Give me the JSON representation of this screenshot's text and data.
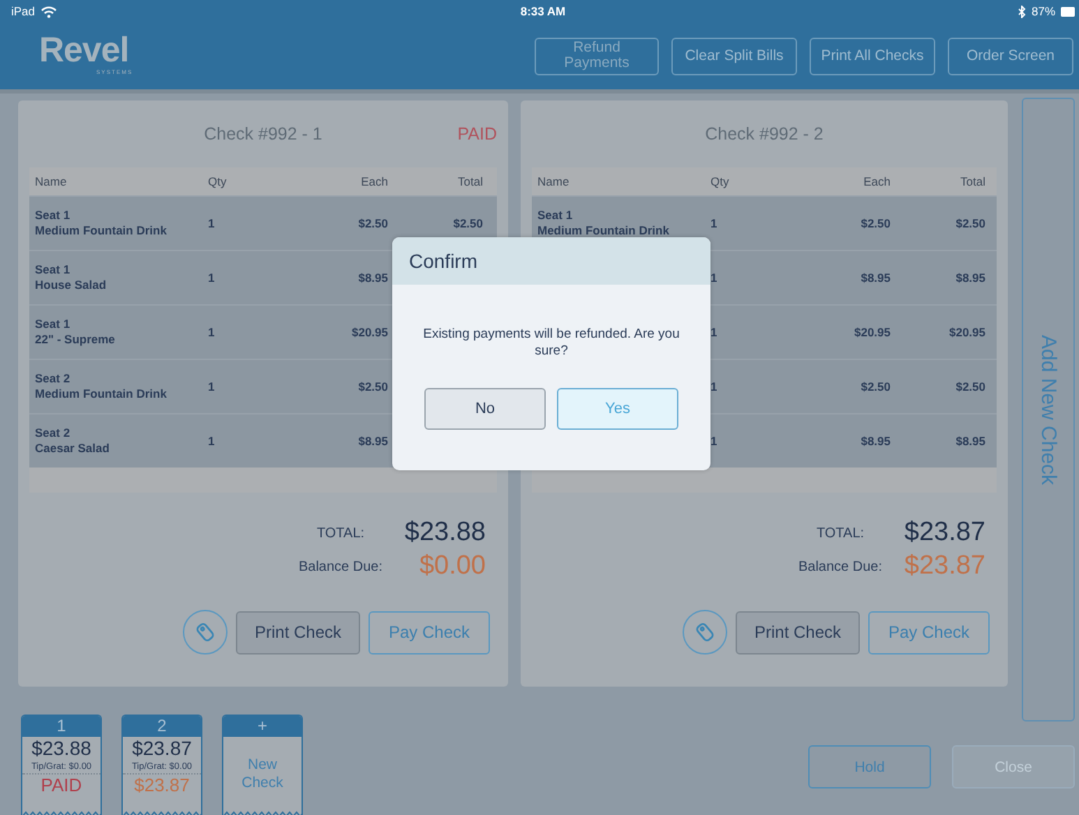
{
  "status_bar": {
    "device": "iPad",
    "time": "8:33 AM",
    "battery": "87%"
  },
  "header": {
    "logo": "Revel",
    "logo_sub": "SYSTEMS",
    "buttons": [
      "Refund Payments",
      "Clear Split Bills",
      "Print All Checks",
      "Order Screen"
    ]
  },
  "checks": [
    {
      "title": "Check #992 - 1",
      "status": "PAID",
      "columns": [
        "Name",
        "Qty",
        "Each",
        "Total"
      ],
      "rows": [
        {
          "seat": "Seat 1",
          "item": "Medium Fountain Drink",
          "qty": "1",
          "each": "$2.50",
          "total": "$2.50"
        },
        {
          "seat": "Seat 1",
          "item": "House Salad",
          "qty": "1",
          "each": "$8.95"
        },
        {
          "seat": "Seat 1",
          "item": "22\" - Supreme",
          "qty": "1",
          "each": "$20.95"
        },
        {
          "seat": "Seat 2",
          "item": "Medium Fountain Drink",
          "qty": "1",
          "each": "$2.50"
        },
        {
          "seat": "Seat 2",
          "item": "Caesar Salad",
          "qty": "1",
          "each": "$8.95"
        }
      ],
      "total_label": "TOTAL:",
      "total": "$23.88",
      "balance_label": "Balance Due:",
      "balance": "$0.00",
      "buttons": [
        "Print Check",
        "Pay Check"
      ]
    },
    {
      "title": "Check #992 - 2",
      "columns": [
        "Name",
        "Qty",
        "Each",
        "Total"
      ],
      "rows": [
        {
          "seat": "Seat 1",
          "item": "Medium Fountain Drink",
          "qty": "1",
          "each": "$2.50",
          "total": "$2.50"
        },
        {
          "qty": "1",
          "each": "$8.95",
          "total": "$8.95"
        },
        {
          "qty": "1",
          "each": "$20.95",
          "total": "$20.95"
        },
        {
          "qty": "1",
          "each": "$2.50",
          "total": "$2.50"
        },
        {
          "qty": "1",
          "each": "$8.95",
          "total": "$8.95"
        }
      ],
      "total_label": "TOTAL:",
      "total": "$23.87",
      "balance_label": "Balance Due:",
      "balance": "$23.87",
      "buttons": [
        "Print Check",
        "Pay Check"
      ]
    }
  ],
  "add_check": "Add New Check",
  "check_tabs": [
    {
      "kind": "check",
      "number": "1",
      "amount": "$23.88",
      "tip": "Tip/Grat: $0.00",
      "status": "PAID",
      "paid": true
    },
    {
      "kind": "check",
      "number": "2",
      "amount": "$23.87",
      "tip": "Tip/Grat: $0.00",
      "status": "$23.87",
      "paid": false
    },
    {
      "kind": "new",
      "number": "+",
      "label": "New Check"
    }
  ],
  "footer_buttons": [
    {
      "label": "Hold",
      "disabled": false
    },
    {
      "label": "Close",
      "disabled": true
    }
  ],
  "dialog": {
    "title": "Confirm",
    "message": "Existing payments will be refunded. Are you sure?",
    "buttons": [
      {
        "label": "No",
        "kind": "default"
      },
      {
        "label": "Yes",
        "kind": "primary"
      }
    ]
  }
}
